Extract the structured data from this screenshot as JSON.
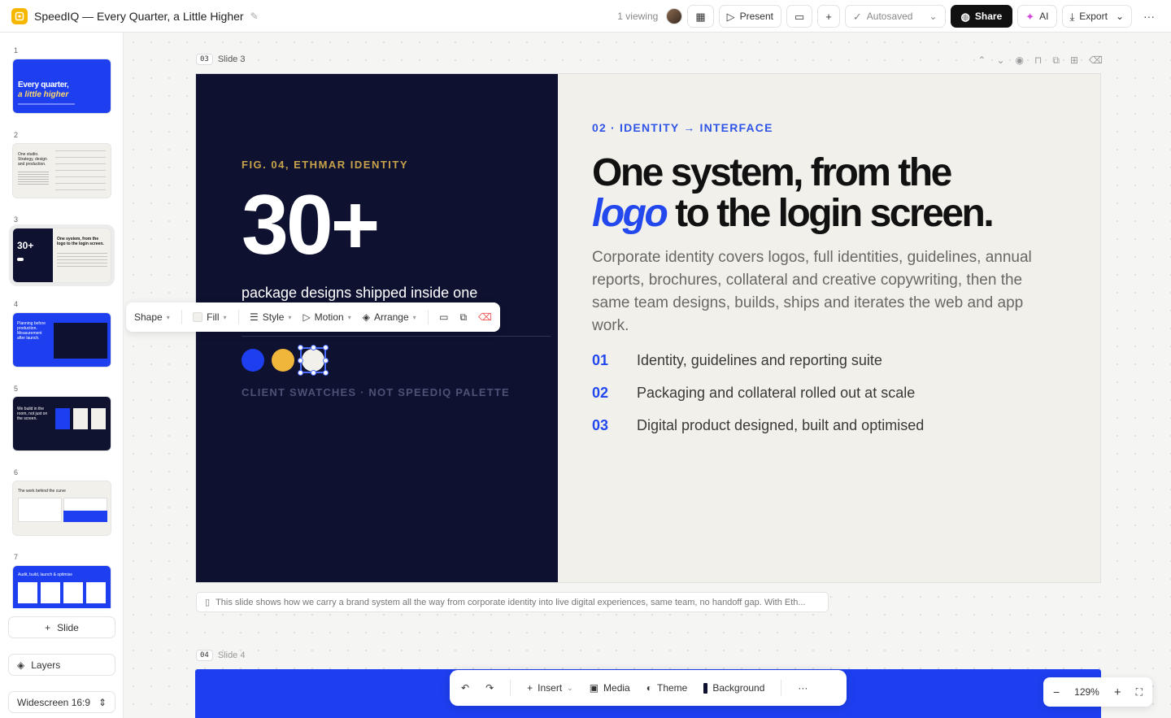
{
  "app": {
    "title": "SpeedIQ — Every Quarter, a Little Higher"
  },
  "topbar": {
    "viewing": "1 viewing",
    "present": "Present",
    "autosaved": "Autosaved",
    "share": "Share",
    "ai": "AI",
    "export": "Export"
  },
  "sidebar": {
    "slides": [
      {
        "num": "1",
        "title": "Every quarter,",
        "subtitle": "a little higher"
      },
      {
        "num": "2",
        "title": "One studio. Strategy, design and production."
      },
      {
        "num": "3",
        "title": "30+",
        "subtitle": "One system, from the logo to the login screen."
      },
      {
        "num": "4",
        "title": "Planning before production. Measurement after launch."
      },
      {
        "num": "5",
        "title": "We build in the room, not just on the screen."
      },
      {
        "num": "6",
        "title": "The work behind the curve"
      },
      {
        "num": "7",
        "title": "Audit, build, launch & optimise"
      }
    ],
    "add_slide": "Slide",
    "layers": "Layers",
    "format": "Widescreen 16:9"
  },
  "canvas": {
    "slide3_num": "03",
    "slide3_label": "Slide 3",
    "slide4_num": "04",
    "slide4_label": "Slide 4",
    "notes": "This slide shows how we carry a brand system all the way from corporate identity into live digital experiences, same team, no handoff gap. With Eth..."
  },
  "slide": {
    "fig": "FIG. 04, ETHMAR IDENTITY",
    "big": "30+",
    "package": "package designs shipped inside one",
    "client_swatches": "CLIENT SWATCHES · NOT SPEEDIQ PALETTE",
    "eyebrow": "02 · IDENTITY → INTERFACE",
    "headline_1": "One system, from the",
    "headline_logo": "logo",
    "headline_2": " to the login screen.",
    "body": "Corporate identity covers logos, full identities, guidelines, annual reports, brochures, collateral and creative copywriting, then the same team designs, builds, ships and iterates the web and app work.",
    "items": [
      {
        "num": "01",
        "text": "Identity, guidelines and reporting suite"
      },
      {
        "num": "02",
        "text": "Packaging and collateral rolled out at scale"
      },
      {
        "num": "03",
        "text": "Digital product designed, built and optimised"
      }
    ],
    "swatches": [
      "#1d3ff0",
      "#f0b63c",
      "#f2f0ea"
    ]
  },
  "float_toolbar": {
    "shape": "Shape",
    "fill": "Fill",
    "style": "Style",
    "motion": "Motion",
    "arrange": "Arrange"
  },
  "bottom_toolbar": {
    "insert": "Insert",
    "media": "Media",
    "theme": "Theme",
    "background": "Background"
  },
  "zoom": {
    "level": "129%"
  },
  "colors": {
    "accent": "#2248ee",
    "navy": "#0e1130",
    "gold": "#c8a24a",
    "cream": "#f2f0ea"
  }
}
